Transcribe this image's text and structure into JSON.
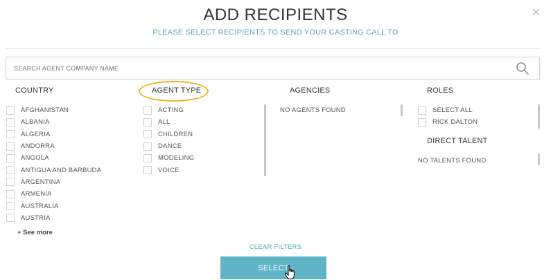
{
  "modal": {
    "title": "ADD RECIPIENTS",
    "subtitle": "PLEASE SELECT RECIPIENTS TO SEND YOUR CASTING CALL TO",
    "close_icon": "close-icon"
  },
  "search": {
    "placeholder": "SEARCH AGENT COMPANY NAME",
    "value": "",
    "icon": "search-icon"
  },
  "columns": {
    "country": {
      "heading": "COUNTRY",
      "items": [
        "AFGHANISTAN",
        "ALBANIA",
        "ALGERIA",
        "ANDORRA",
        "ANGOLA",
        "ANTIGUA AND BARBUDA",
        "ARGENTINA",
        "ARMENIA",
        "AUSTRALIA",
        "AUSTRIA"
      ],
      "see_more": "+ See more"
    },
    "agent_type": {
      "heading": "AGENT TYPE",
      "items": [
        "ACTING",
        "ALL",
        "CHILDREN",
        "DANCE",
        "MODELING",
        "VOICE"
      ],
      "highlight_color": "#f2b51b"
    },
    "agencies": {
      "heading": "AGENCIES",
      "empty_text": "NO AGENTS FOUND"
    },
    "roles": {
      "heading": "ROLES",
      "items": [
        "SELECT ALL",
        "RICK DALTON"
      ]
    },
    "direct_talent": {
      "heading": "DIRECT TALENT",
      "empty_text": "NO TALENTS FOUND"
    }
  },
  "footer": {
    "clear_filters": "CLEAR FILTERS",
    "select_label": "SELECT"
  },
  "colors": {
    "accent": "#5aa9bd",
    "button": "#5fb5c6",
    "highlight": "#f2b51b"
  }
}
